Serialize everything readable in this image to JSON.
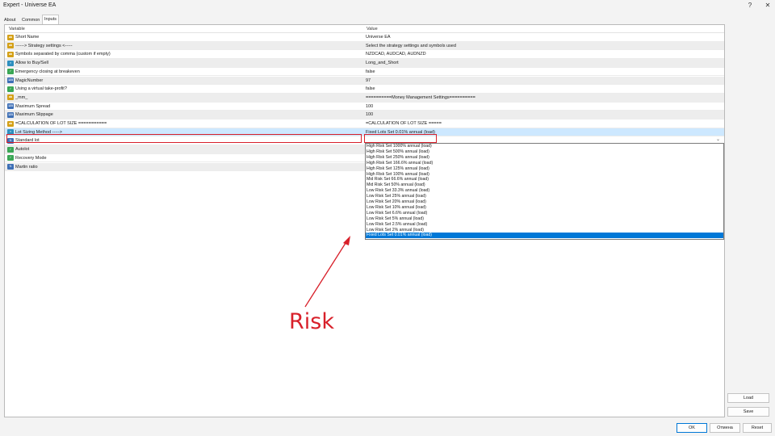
{
  "window": {
    "title": "Expert - Universe EA",
    "help_glyph": "?",
    "close_glyph": "✕"
  },
  "tabs": [
    {
      "label": "About",
      "active": false
    },
    {
      "label": "Common",
      "active": false
    },
    {
      "label": "Inputs",
      "active": true
    }
  ],
  "table": {
    "col_variable": "Variable",
    "col_value": "Value",
    "rows": [
      {
        "icon": "ab",
        "variable": "Short Name",
        "value": "Universe EA"
      },
      {
        "icon": "ab",
        "variable": "------> Strategy settings <-----",
        "value": "Select the strategy settings and symbols used"
      },
      {
        "icon": "ab",
        "variable": "Symbols separated by comma (custom if empty)",
        "value": "NZDCAD, AUDCAD, AUDNZD"
      },
      {
        "icon": "list",
        "variable": "Allow to Buy/Sell",
        "value": "Long_and_Short"
      },
      {
        "icon": "bool",
        "variable": "Emergency closing at breakeven",
        "value": "false"
      },
      {
        "icon": "v12",
        "variable": "MagicNumber",
        "value": "97"
      },
      {
        "icon": "bool",
        "variable": "Using a virtual take-profit?",
        "value": "false"
      },
      {
        "icon": "ab",
        "variable": "_mm_",
        "value": "==========Money Management Settings=========="
      },
      {
        "icon": "v12",
        "variable": "Maximum Spread",
        "value": "100"
      },
      {
        "icon": "v12",
        "variable": "Maximum Slippage",
        "value": "100"
      },
      {
        "icon": "ab",
        "variable": "=CALCULATION OF LOT SIZE ===========",
        "value": "=CALCULATION OF LOT SIZE ====="
      },
      {
        "icon": "list",
        "variable": "Lot Sizing Method ----->",
        "value": "Fixed Lots Set 0.01% annual (load)"
      },
      {
        "icon": "num",
        "variable": "Standard lot",
        "value": ""
      },
      {
        "icon": "bool",
        "variable": "Autolot",
        "value": ""
      },
      {
        "icon": "bool",
        "variable": "Recovery Mode",
        "value": ""
      },
      {
        "icon": "num",
        "variable": "Martin ratio",
        "value": ""
      }
    ]
  },
  "dropdown": {
    "options": [
      "High Risk Set 1000% annual (load)",
      "High Risk Set 500% annual (load)",
      "High Risk Set 250% annual (load)",
      "High Risk Set 166.6% annual (load)",
      "High Risk Set 125% annual (load)",
      "High Risk Set 100% annual (load)",
      "Mid Risk Set 66.6% annual (load)",
      "Mid Risk Set 50% annual (load)",
      "Low Risk Set 33.3% annual (load)",
      "Low Risk Set 25% annual (load)",
      "Low Risk Set 20% annual (load)",
      "Low Risk Set 10% annual (load)",
      "Low Risk Set 6.6% annual (load)",
      "Low Risk Set 5% annual (load)",
      "Low Risk Set 2.5% annual (load)",
      "Low Risk Set 2% annual (load)",
      "Fixed Lots Set 0.01% annual (load)"
    ],
    "selected_index": 16,
    "arrow_glyph": "⌄"
  },
  "buttons": {
    "load": "Load",
    "save": "Save",
    "ok": "OK",
    "cancel": "Отмена",
    "reset": "Reset"
  },
  "annotation": {
    "text": "Risk",
    "color": "#d8202a"
  }
}
